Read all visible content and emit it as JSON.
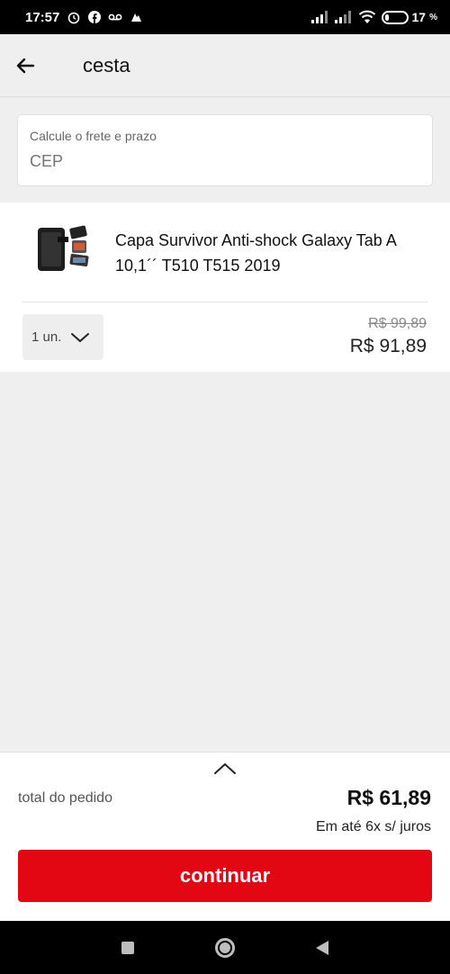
{
  "status_bar": {
    "time": "17:57",
    "battery_percent": "17",
    "battery_level": 0.17
  },
  "header": {
    "title": "cesta"
  },
  "shipping": {
    "label": "Calcule o frete e prazo",
    "placeholder": "CEP"
  },
  "cart": {
    "items": [
      {
        "name": "Capa Survivor Anti-shock Galaxy Tab A 10,1´´ T510 T515 2019",
        "quantity": "1 un.",
        "price_original": "R$ 99,89",
        "price_current": "R$ 91,89"
      }
    ]
  },
  "summary": {
    "total_label": "total do pedido",
    "total_value": "R$ 61,89",
    "installments": "Em até 6x s/ juros",
    "continue_label": "continuar"
  },
  "colors": {
    "accent": "#e30613"
  }
}
